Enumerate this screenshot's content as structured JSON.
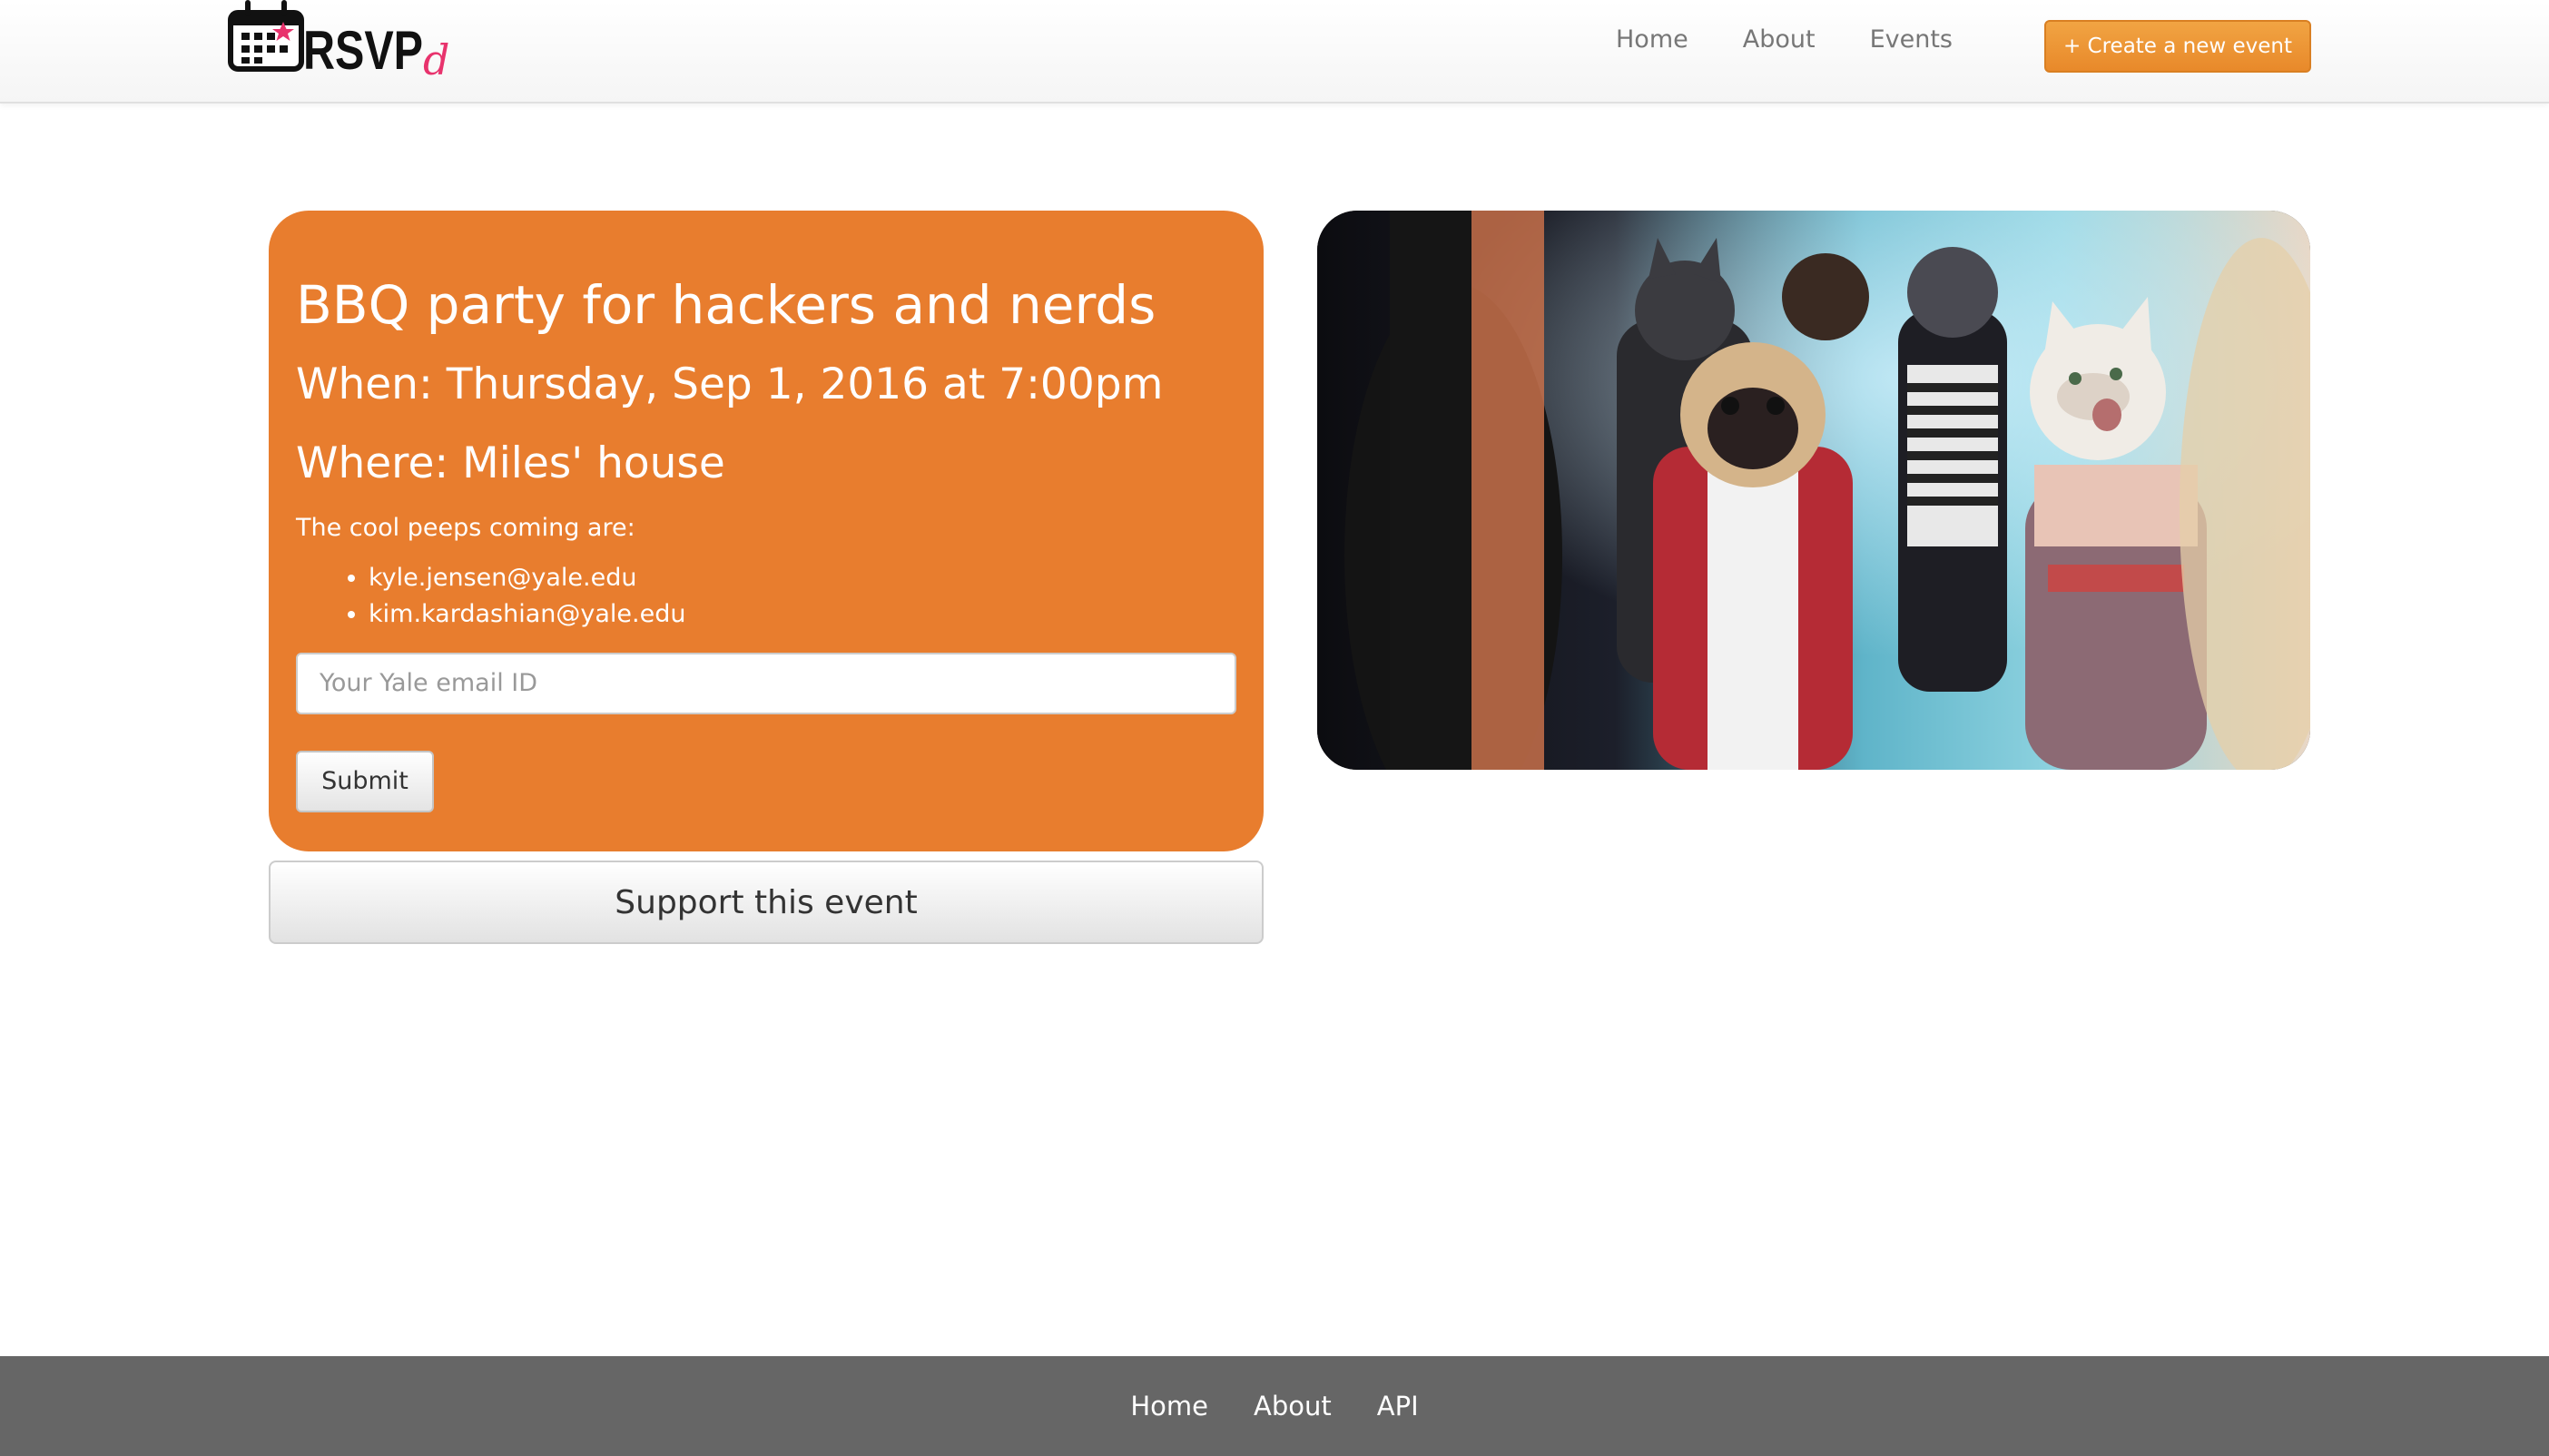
{
  "brand": {
    "logo_text": "RSVP",
    "logo_suffix": "d",
    "accent_color": "#e87d2e",
    "logo_star_color": "#e8336d"
  },
  "nav": {
    "links": [
      "Home",
      "About",
      "Events"
    ],
    "create_button": "+ Create a new event"
  },
  "event": {
    "title": "BBQ party for hackers and nerds",
    "when": "When: Thursday, Sep 1, 2016 at 7:00pm",
    "where": "Where: Miles' house",
    "attendees_intro": "The cool peeps coming are:",
    "attendees": [
      "kyle.jensen@yale.edu",
      "kim.kardashian@yale.edu"
    ],
    "email_placeholder": "Your Yale email ID",
    "email_value": "",
    "submit_label": "Submit",
    "support_label": "Support this event"
  },
  "image": {
    "icon": "party-animals-photo"
  },
  "footer": {
    "links": [
      "Home",
      "About",
      "API"
    ],
    "background_color": "#666666"
  }
}
